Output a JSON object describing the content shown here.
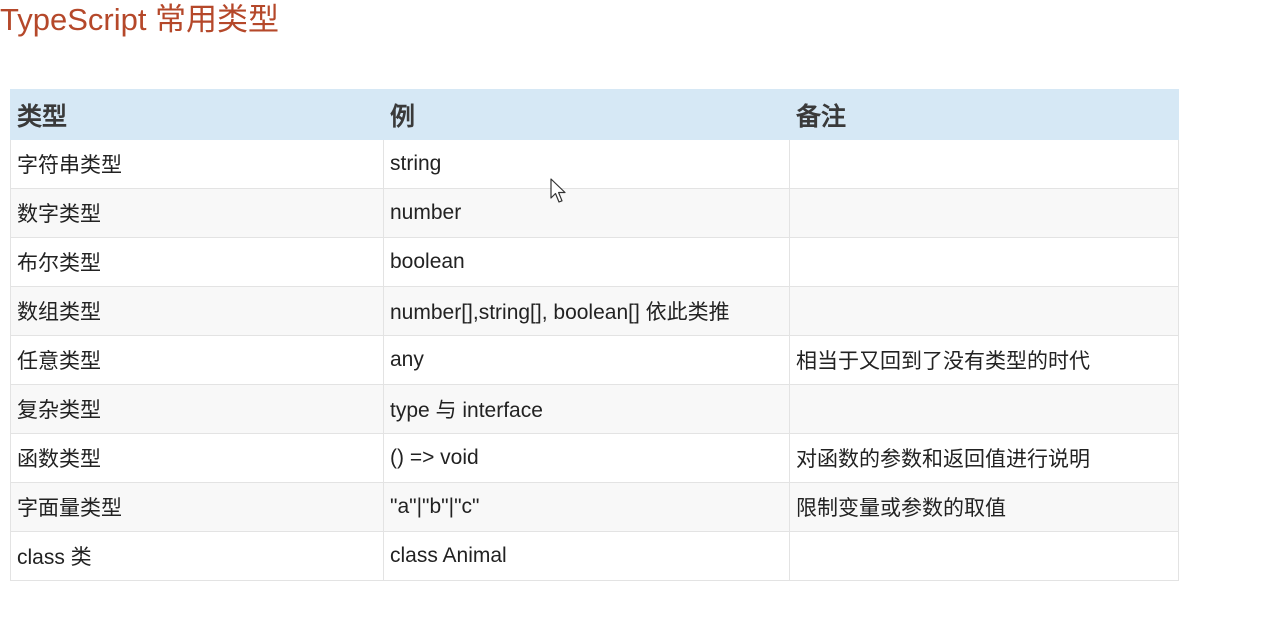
{
  "title": "TypeScript 常用类型",
  "table": {
    "headers": [
      "类型",
      "例",
      "备注"
    ],
    "rows": [
      [
        "字符串类型",
        "string",
        ""
      ],
      [
        "数字类型",
        "number",
        ""
      ],
      [
        "布尔类型",
        "boolean",
        ""
      ],
      [
        "数组类型",
        "number[],string[], boolean[] 依此类推",
        ""
      ],
      [
        "任意类型",
        "any",
        "相当于又回到了没有类型的时代"
      ],
      [
        "复杂类型",
        "type 与 interface",
        ""
      ],
      [
        "函数类型",
        "() => void",
        "对函数的参数和返回值进行说明"
      ],
      [
        "字面量类型",
        "\"a\"|\"b\"|\"c\"",
        "限制变量或参数的取值"
      ],
      [
        "class 类",
        "class Animal",
        ""
      ]
    ]
  },
  "icons": {
    "cursor": "mouse-pointer-icon"
  }
}
